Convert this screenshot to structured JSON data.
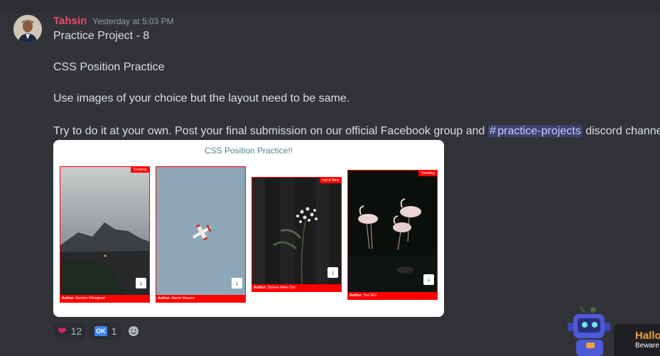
{
  "message": {
    "username": "Tahsin",
    "timestamp": "Yesterday at 5:03 PM",
    "lines": [
      "Practice Project - 8",
      "CSS Position Practice",
      "Use images of your choice but the layout need to be same.",
      "Try to do it at your own. Post your final submission on our official Facebook group and"
    ],
    "channel_mention": "practice-projects",
    "after_mention": "discord channel."
  },
  "attachment": {
    "title": "CSS Position Practice!!",
    "cards": [
      {
        "badge": "Trending",
        "author_label": "Author:",
        "author_name": "Karsten Winegeart"
      },
      {
        "badge": "",
        "author_label": "Author:",
        "author_name": "Martin Masson"
      },
      {
        "badge": "Hot & New",
        "author_label": "Author:",
        "author_name": "Sixteen Miles Out"
      },
      {
        "badge": "Trending",
        "author_label": "Author:",
        "author_name": "Yue WU"
      }
    ]
  },
  "reactions": [
    {
      "icon": "heart-icon",
      "count": "12"
    },
    {
      "icon": "ok-icon",
      "label": "OK",
      "count": "1"
    }
  ],
  "promo": {
    "heading": "Hallo",
    "sub": "Beware"
  },
  "colors": {
    "background": "#313338",
    "username": "#e74c6c",
    "accent_red": "#ff0000",
    "mention": "#c9cdfb"
  }
}
